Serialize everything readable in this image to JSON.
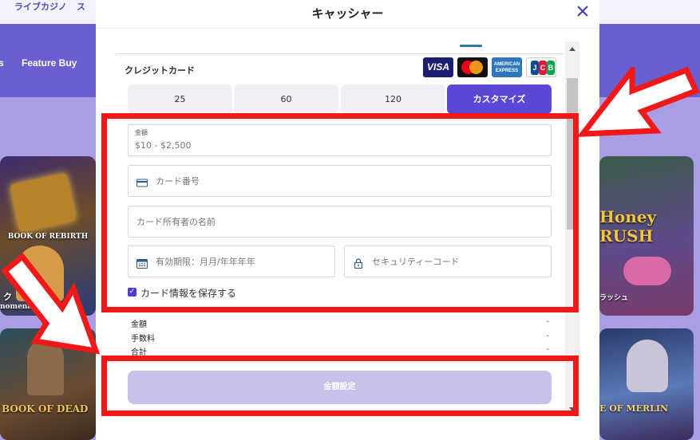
{
  "background": {
    "topbar_links": [
      "ライブカジノ",
      "ス"
    ],
    "nav_items": [
      "s",
      "Feature Buy"
    ],
    "tiles": [
      {
        "caption": "BOOK OF REBIRTH"
      },
      {
        "caption": "ク"
      },
      {
        "caption": "nomenal"
      },
      {
        "caption": "BOOK OF DEAD"
      },
      {
        "caption": "Honey RUSH"
      },
      {
        "caption": "ラッシュ"
      },
      {
        "caption": "E OF MERLIN"
      }
    ]
  },
  "modal": {
    "title": "キャッシャー",
    "close_icon": "close-icon",
    "section_label": "クレジットカード",
    "card_logos": [
      {
        "name": "visa",
        "text": "VISA"
      },
      {
        "name": "mastercard",
        "text": ""
      },
      {
        "name": "american-express",
        "text": "AMERICAN EXPRESS"
      },
      {
        "name": "jcb",
        "text": "JCB"
      }
    ],
    "amount_buttons": [
      {
        "label": "25",
        "active": false
      },
      {
        "label": "60",
        "active": false
      },
      {
        "label": "120",
        "active": false
      },
      {
        "label": "カスタマイズ",
        "active": true
      }
    ],
    "amount_field": {
      "label": "金額",
      "placeholder": "$10 - $2,500"
    },
    "card_number_field": {
      "placeholder": "カード番号",
      "icon": "credit-card-icon"
    },
    "card_holder_field": {
      "placeholder": "カード所有者の名前"
    },
    "expiry_field": {
      "placeholder": "有効期限：月月/年年年年",
      "icon": "calendar-icon"
    },
    "cvv_field": {
      "placeholder": "セキュリティーコード",
      "icon": "lock-icon"
    },
    "save_card": {
      "label": "カード情報を保存する",
      "checked": true
    },
    "summary": [
      {
        "label": "金額",
        "value": "-"
      },
      {
        "label": "手数料",
        "value": "-"
      },
      {
        "label": "合計",
        "value": "-"
      }
    ],
    "submit_label": "金額設定"
  },
  "colors": {
    "accent": "#5b47d6",
    "annotation_red": "#f01818",
    "submit_disabled": "#c7c2ec"
  }
}
